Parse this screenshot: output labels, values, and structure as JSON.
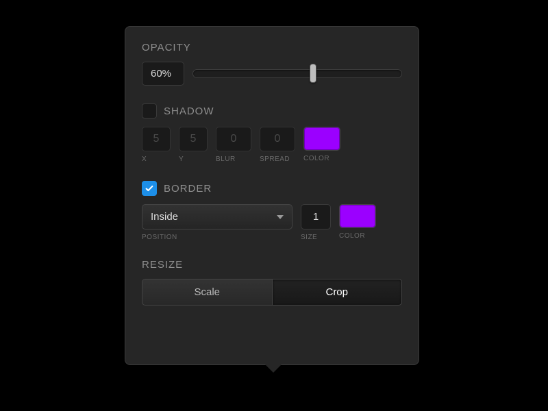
{
  "opacity": {
    "title": "OPACITY",
    "value": "60%",
    "slider_percent": 60
  },
  "shadow": {
    "title": "SHADOW",
    "checked": false,
    "x": {
      "value": "5",
      "label": "X"
    },
    "y": {
      "value": "5",
      "label": "Y"
    },
    "blur": {
      "value": "0",
      "label": "BLUR"
    },
    "spread": {
      "value": "0",
      "label": "SPREAD"
    },
    "color": {
      "value": "#9b00ff",
      "label": "COLOR"
    }
  },
  "border": {
    "title": "BORDER",
    "checked": true,
    "position": {
      "value": "Inside",
      "label": "POSITION"
    },
    "size": {
      "value": "1",
      "label": "SIZE"
    },
    "color": {
      "value": "#9b00ff",
      "label": "COLOR"
    }
  },
  "resize": {
    "title": "RESIZE",
    "options": {
      "scale": "Scale",
      "crop": "Crop"
    },
    "active": "crop"
  }
}
